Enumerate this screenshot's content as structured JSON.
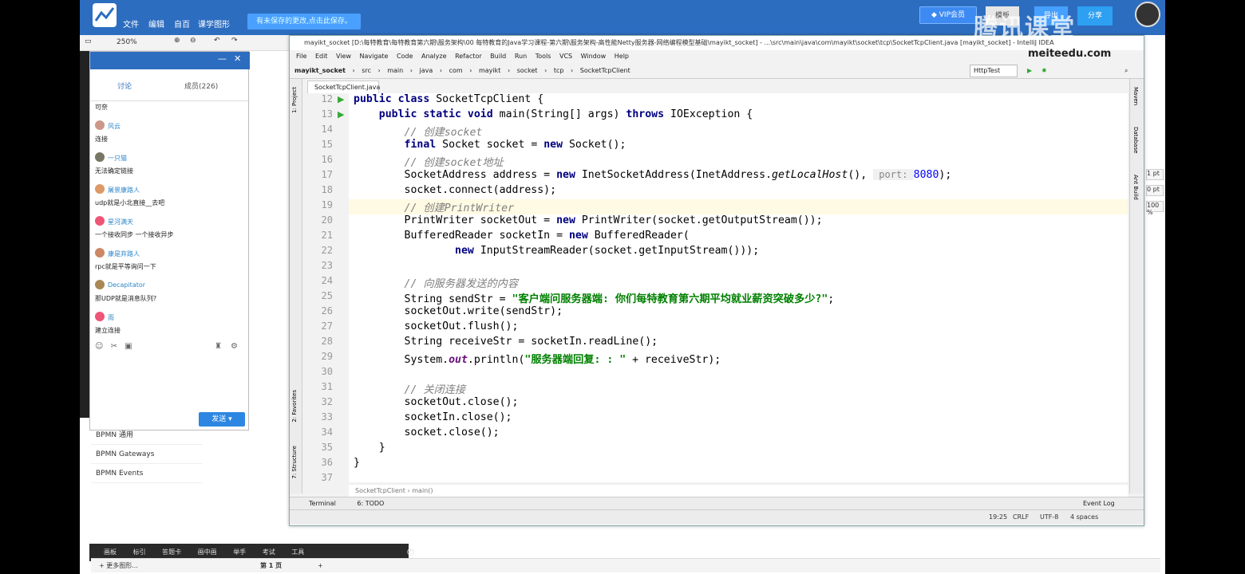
{
  "app": {
    "menu": [
      "文件",
      "编辑",
      "自百",
      "课学图形"
    ],
    "save_banner": "有未保存的更改,点击此保存。",
    "vip_label": "VIP会员",
    "log_label": "模板",
    "login_label": "导出",
    "share_label": "分享",
    "zoom": "250%"
  },
  "watermark": {
    "title": "腾讯课堂",
    "sub": "meiteedu.com"
  },
  "chat": {
    "tabs": [
      "讨论",
      "成员(226)"
    ],
    "messages": [
      {
        "name": "",
        "text": "可奈"
      },
      {
        "name": "风云",
        "text": "连接"
      },
      {
        "name": "一只猫",
        "text": "无法确定链接"
      },
      {
        "name": "屠景康路人",
        "text": "udp就是小北直接__去吧"
      },
      {
        "name": "星河满天",
        "text": "一个接收同步 一个接收异步"
      },
      {
        "name": "康是弃路人",
        "text": "rpc就是平等询问一下"
      },
      {
        "name": "Decapitator",
        "text": "那UDP就是消息队列?"
      },
      {
        "name": "雨",
        "text": "建立连接"
      }
    ],
    "send_label": "发送"
  },
  "bpmn": [
    "BPMN 通用",
    "BPMN Gateways",
    "BPMN Events"
  ],
  "ide": {
    "title": "mayikt_socket [D:\\每特教育\\每特教育第六期\\服务架构\\00 每特教育的Java学习课程-第六期\\服务架构-高性能Netty服务器-网络编程模型基础\\mayikt_socket] - ...\\src\\main\\java\\com\\mayikt\\socket\\tcp\\SocketTcpClient.java [mayikt_socket] - IntelliJ IDEA",
    "menu": [
      "File",
      "Edit",
      "View",
      "Navigate",
      "Code",
      "Analyze",
      "Refactor",
      "Build",
      "Run",
      "Tools",
      "VCS",
      "Window",
      "Help"
    ],
    "nav": [
      "mayikt_socket",
      "src",
      "main",
      "java",
      "com",
      "mayikt",
      "socket",
      "tcp",
      "SocketTcpClient"
    ],
    "run_config": "HttpTest",
    "file_tab": "SocketTcpClient.java",
    "side_left": [
      "1: Project",
      "2: Favorites",
      "7: Structure"
    ],
    "side_right": [
      "Maven",
      "Database",
      "Ant Build"
    ],
    "line_numbers": [
      "12",
      "13",
      "14",
      "15",
      "16",
      "17",
      "18",
      "19",
      "20",
      "21",
      "22",
      "23",
      "24",
      "25",
      "26",
      "27",
      "28",
      "29",
      "30",
      "31",
      "32",
      "33",
      "34",
      "35",
      "36",
      "37"
    ],
    "breadcrumb": [
      "SocketTcpClient",
      "main()"
    ],
    "bottom_tabs": [
      "Terminal",
      "6: TODO"
    ],
    "event_log": "Event Log",
    "status": {
      "position": "19:25",
      "line_sep": "CRLF",
      "encoding": "UTF-8",
      "indent": "4 spaces"
    }
  },
  "code_lines": {
    "l12a": "public class ",
    "l12b": "SocketTcpClient {",
    "l13a": "    public static void ",
    "l13b": "main(String[] args) ",
    "l13c": "throws ",
    "l13d": "IOException {",
    "l14": "        // 创建socket",
    "l15a": "        ",
    "l15b": "final ",
    "l15c": "Socket socket = ",
    "l15d": "new ",
    "l15e": "Socket();",
    "l16": "        // 创建socket地址",
    "l17a": "        SocketAddress address = ",
    "l17b": "new ",
    "l17c": "InetSocketAddress(InetAddress.",
    "l17d": "getLocalHost",
    "l17e": "(), ",
    "l17f": " port: ",
    "l17g": "8080",
    "l17h": ");",
    "l18": "        socket.connect(address);",
    "l19": "        // 创建PrintWriter",
    "l20a": "        PrintWriter socketOut = ",
    "l20b": "new ",
    "l20c": "PrintWriter(socket.getOutputStream());",
    "l21a": "        BufferedReader socketIn = ",
    "l21b": "new ",
    "l21c": "BufferedReader(",
    "l22a": "                ",
    "l22b": "new ",
    "l22c": "InputStreamReader(socket.getInputStream()));",
    "l24": "        // 向服务器发送的内容",
    "l25a": "        String sendStr = ",
    "l25b": "\"客户端问服务器端: 你们每特教育第六期平均就业薪资突破多少?\"",
    "l25c": ";",
    "l26": "        socketOut.write(sendStr);",
    "l27": "        socketOut.flush();",
    "l28": "        String receiveStr = socketIn.readLine();",
    "l29a": "        System.",
    "l29b": "out",
    "l29c": ".println(",
    "l29d": "\"服务器端回复: : \"",
    "l29e": " + receiveStr);",
    "l31": "        // 关闭连接",
    "l32": "        socketOut.close();",
    "l33": "        socketIn.close();",
    "l34": "        socket.close();",
    "l35": "    }",
    "l36": "}"
  },
  "taskbar": [
    "画板",
    "标引",
    "答题卡",
    "画中画",
    "举手",
    "考试",
    "工具"
  ],
  "pagebar": {
    "more": "+ 更多图形...",
    "page": "第 1 页"
  },
  "right_panel": [
    "1 pt",
    "0 pt",
    "100 %"
  ]
}
